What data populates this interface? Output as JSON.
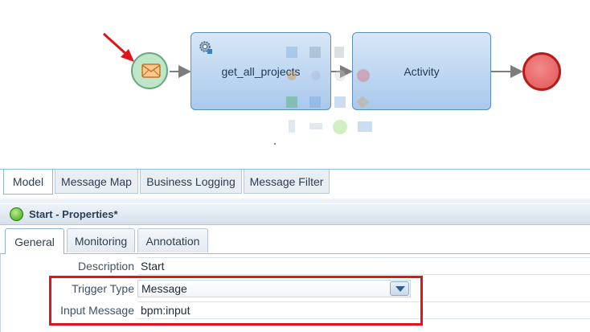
{
  "diagram": {
    "task1_label": "get_all_projects",
    "task2_label": "Activity",
    "colors": {
      "start_fill": "#bfe6c9",
      "end_fill": "#e25454",
      "task_fill": "#a9c9ec",
      "arrow": "#e0141b"
    }
  },
  "editor_tabs": [
    {
      "label": "Model",
      "active": true
    },
    {
      "label": "Message Map",
      "active": false
    },
    {
      "label": "Business Logging",
      "active": false
    },
    {
      "label": "Message Filter",
      "active": false
    }
  ],
  "properties": {
    "title": "Start - Properties*",
    "tabs": [
      {
        "label": "General",
        "active": true
      },
      {
        "label": "Monitoring",
        "active": false
      },
      {
        "label": "Annotation",
        "active": false
      }
    ],
    "fields": {
      "description": {
        "label": "Description",
        "value": "Start"
      },
      "trigger_type": {
        "label": "Trigger Type",
        "value": "Message"
      },
      "input_message": {
        "label": "Input Message",
        "value": "bpm:input"
      }
    }
  }
}
